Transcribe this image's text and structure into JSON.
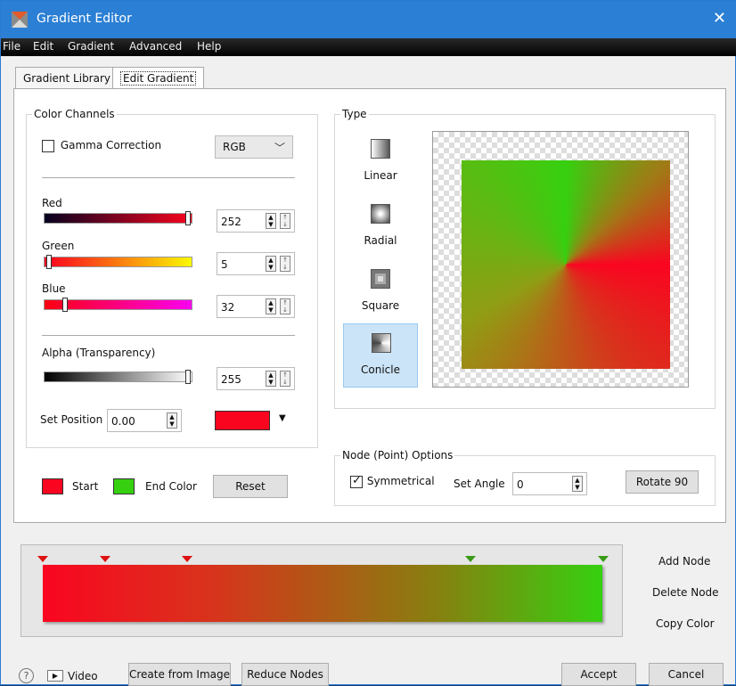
{
  "window": {
    "title": "Gradient Editor",
    "close": "✕",
    "icon": "gradient-editor-icon"
  },
  "menu": [
    "File",
    "Edit",
    "Gradient",
    "Advanced",
    "Help"
  ],
  "tabs": [
    "Gradient Library",
    "Edit Gradient"
  ],
  "color_channels": {
    "legend": "Color Channels",
    "gamma_label": "Gamma Correction",
    "gamma_checked": false,
    "mode": "RGB",
    "red_label": "Red",
    "red_value": "252",
    "green_label": "Green",
    "green_value": "5",
    "blue_label": "Blue",
    "blue_value": "32",
    "alpha_label": "Alpha (Transparency)",
    "alpha_value": "255",
    "position_label": "Set Position",
    "position_value": "0.00",
    "color": "#fa0520"
  },
  "type": {
    "legend": "Type",
    "options": [
      "Linear",
      "Radial",
      "Square",
      "Conicle"
    ],
    "selected": "Conicle"
  },
  "node_options": {
    "legend": "Node (Point) Options",
    "symmetrical_label": "Symmetrical",
    "symmetrical_checked": true,
    "angle_label": "Set Angle",
    "angle_value": "0",
    "rotate_label": "Rotate 90"
  },
  "start_end": {
    "start_label": "Start",
    "end_label": "End Color",
    "reset_label": "Reset",
    "start_color": "#fa0520",
    "end_color": "#36d010"
  },
  "node_actions": [
    "Add Node",
    "Delete Node",
    "Copy Color"
  ],
  "bottom": {
    "help": "?",
    "video_label": "Video",
    "create_label": "Create from Image",
    "reduce_label": "Reduce Nodes",
    "accept_label": "Accept",
    "cancel_label": "Cancel"
  }
}
